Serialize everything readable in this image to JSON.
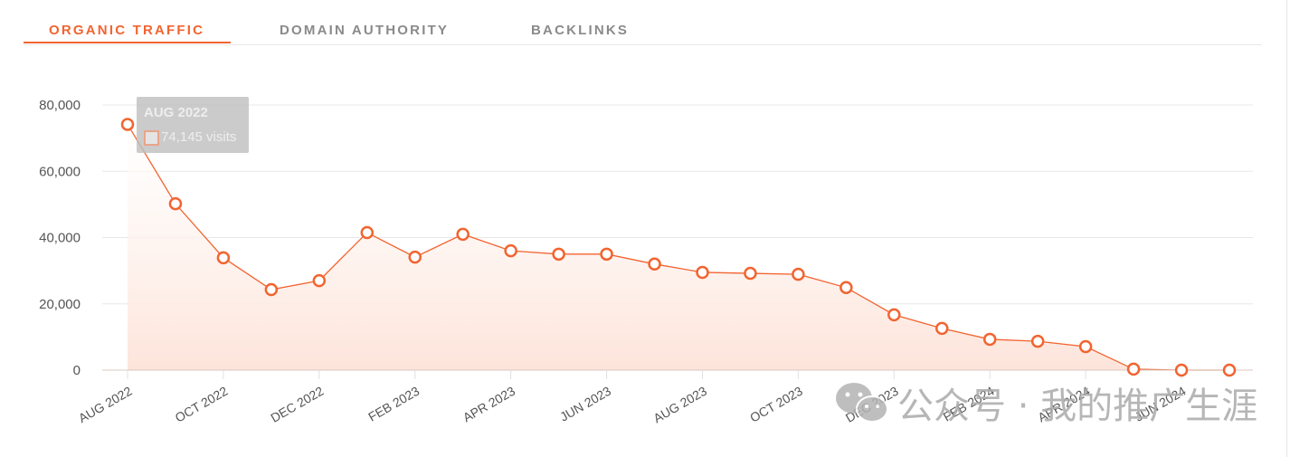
{
  "tabs": [
    {
      "label": "ORGANIC TRAFFIC",
      "active": true
    },
    {
      "label": "DOMAIN AUTHORITY",
      "active": false
    },
    {
      "label": "BACKLINKS",
      "active": false
    }
  ],
  "colors": {
    "accent": "#f26430",
    "grid": "#e8e8e8",
    "fill_top": "#ffffff",
    "fill_bottom": "#fde4da"
  },
  "tooltip": {
    "title": "AUG 2022",
    "value": "74,145 visits"
  },
  "watermark": {
    "text": "公众号 · 我的推广生涯",
    "icon": "wechat-icon"
  },
  "chart_data": {
    "type": "area",
    "ylim": [
      0,
      80000
    ],
    "yticks": [
      "0",
      "20,000",
      "40,000",
      "60,000",
      "80,000"
    ],
    "ytick_values": [
      0,
      20000,
      40000,
      60000,
      80000
    ],
    "grid": true,
    "x": [
      "AUG 2022",
      "SEP 2022",
      "OCT 2022",
      "NOV 2022",
      "DEC 2022",
      "JAN 2023",
      "FEB 2023",
      "MAR 2023",
      "APR 2023",
      "MAY 2023",
      "JUN 2023",
      "JUL 2023",
      "AUG 2023",
      "SEP 2023",
      "OCT 2023",
      "NOV 2023",
      "DEC 2023",
      "JAN 2024",
      "FEB 2024",
      "MAR 2024",
      "APR 2024",
      "MAY 2024",
      "JUN 2024",
      "JUL 2024"
    ],
    "xtick_labels": [
      "AUG 2022",
      "OCT 2022",
      "DEC 2022",
      "FEB 2023",
      "APR 2023",
      "JUN 2023",
      "AUG 2023",
      "OCT 2023",
      "DEC 2023",
      "FEB 2024",
      "APR 2024",
      "JUN 2024"
    ],
    "values": [
      74145,
      50200,
      33900,
      24300,
      27000,
      41500,
      34100,
      41000,
      36000,
      35000,
      35000,
      32000,
      29500,
      29200,
      28900,
      24900,
      16700,
      12600,
      9300,
      8700,
      7100,
      300,
      0,
      0
    ]
  }
}
